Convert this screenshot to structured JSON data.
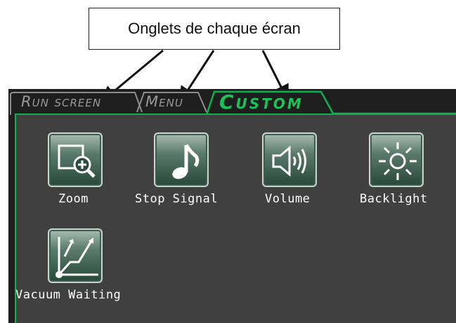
{
  "annotation": {
    "callout_text": "Onglets de chaque écran"
  },
  "tabs": [
    {
      "label": "Run screen",
      "active": false
    },
    {
      "label": "Menu",
      "active": false
    },
    {
      "label": "Custom",
      "active": true
    }
  ],
  "items": [
    {
      "label": "Zoom",
      "icon": "zoom-in-icon"
    },
    {
      "label": "Stop Signal",
      "icon": "music-note-icon"
    },
    {
      "label": "Volume",
      "icon": "speaker-volume-icon"
    },
    {
      "label": "Backlight",
      "icon": "sun-brightness-icon"
    },
    {
      "label": "Vacuum Waiting",
      "icon": "vacuum-graph-icon"
    }
  ],
  "colors": {
    "accent_green": "#19c35a",
    "panel_bg": "#3f403f",
    "screen_bg": "#1d1e1d"
  }
}
